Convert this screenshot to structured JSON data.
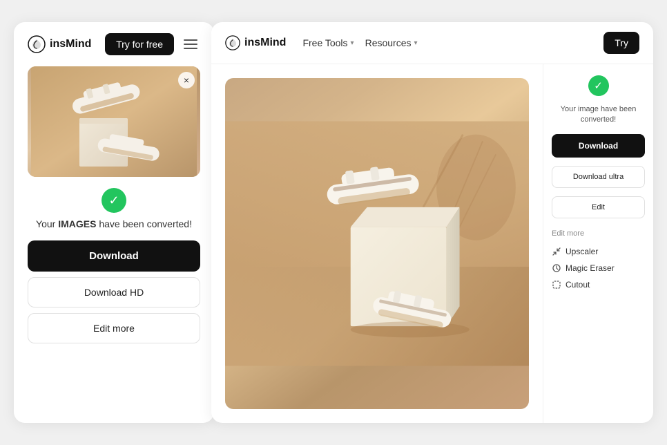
{
  "left_panel": {
    "logo": "insMind",
    "logo_icon": "spiral",
    "try_btn": "Try for free",
    "hamburger_label": "menu",
    "close_label": "×",
    "success_check": "✓",
    "success_message": "Your IMAGES have been converted!",
    "download_btn": "Download",
    "download_hd_btn": "Download HD",
    "edit_more_btn": "Edit more"
  },
  "right_panel": {
    "logo": "insMind",
    "nav": [
      {
        "label": "Free Tools",
        "has_chevron": true
      },
      {
        "label": "Resources",
        "has_chevron": true
      }
    ],
    "try_btn": "Try",
    "sidebar": {
      "success_check": "✓",
      "converted_text": "Your image have been converted!",
      "download_btn": "Download",
      "download_ultra_btn": "Download ultra",
      "edit_btn": "Edit",
      "edit_more_label": "Edit more",
      "edit_items": [
        {
          "icon": "upscaler",
          "label": "Upscaler"
        },
        {
          "icon": "magic-eraser",
          "label": "Magic Eraser"
        },
        {
          "icon": "cutout",
          "label": "Cutout"
        }
      ]
    }
  }
}
